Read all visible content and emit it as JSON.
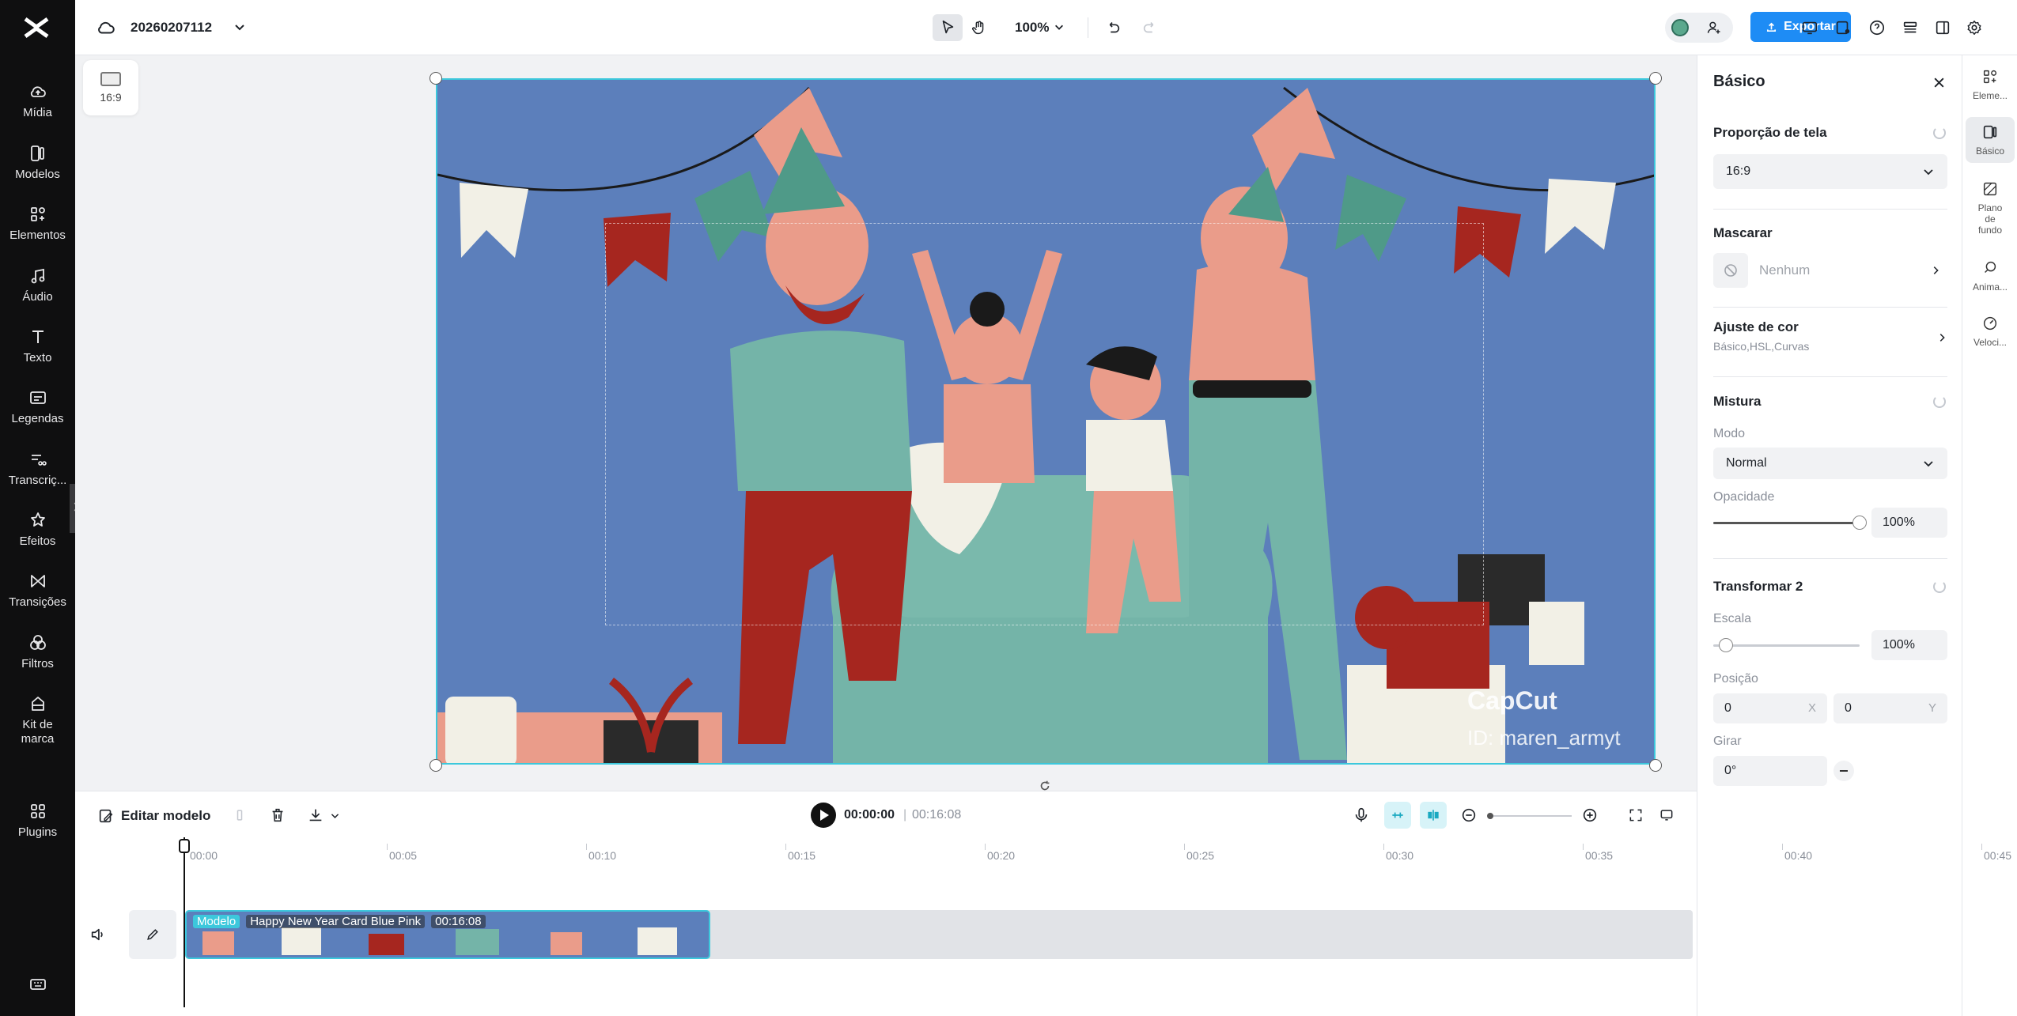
{
  "sidebar": {
    "items": [
      {
        "label": "Mídia",
        "icon": "cloud-upload-icon"
      },
      {
        "label": "Modelos",
        "icon": "templates-icon"
      },
      {
        "label": "Elementos",
        "icon": "elements-icon"
      },
      {
        "label": "Áudio",
        "icon": "music-note-icon"
      },
      {
        "label": "Texto",
        "icon": "text-icon"
      },
      {
        "label": "Legendas",
        "icon": "captions-icon"
      },
      {
        "label": "Transcriç...",
        "icon": "transcript-icon"
      },
      {
        "label": "Efeitos",
        "icon": "effects-star-icon"
      },
      {
        "label": "Transições",
        "icon": "transitions-icon"
      },
      {
        "label": "Filtros",
        "icon": "filters-icon"
      },
      {
        "label": "Kit de marca",
        "icon": "brand-kit-icon"
      },
      {
        "label": "Plugins",
        "icon": "plugins-grid-icon"
      }
    ]
  },
  "topbar": {
    "project_name": "20260207112",
    "zoom": "100%",
    "export_label": "Exportar"
  },
  "canvas": {
    "aspect_ratio": "16:9",
    "watermark_brand": "CapCut",
    "watermark_id": "ID: maren_armyt"
  },
  "panel": {
    "title": "Básico",
    "aspect_section": "Proporção de tela",
    "aspect_value": "16:9",
    "mask_section": "Mascarar",
    "mask_value": "Nenhum",
    "color_section": "Ajuste de cor",
    "color_sub": "Básico,HSL,Curvas",
    "blend_section": "Mistura",
    "mode_label": "Modo",
    "mode_value": "Normal",
    "opacity_label": "Opacidade",
    "opacity_value": "100%",
    "opacity_level": 1.0,
    "transform_section": "Transformar 2",
    "scale_label": "Escala",
    "scale_value": "100%",
    "position_label": "Posição",
    "pos_x": "0",
    "pos_x_tag": "X",
    "pos_y": "0",
    "pos_y_tag": "Y",
    "rotate_label": "Girar",
    "rotate_value": "0°"
  },
  "right_tabs": [
    {
      "label": "Eleme...",
      "icon": "elements-icon"
    },
    {
      "label": "Básico",
      "icon": "basic-icon"
    },
    {
      "label": "Plano de fundo",
      "icon": "background-icon"
    },
    {
      "label": "Anima...",
      "icon": "animation-icon"
    },
    {
      "label": "Veloci...",
      "icon": "speed-icon"
    }
  ],
  "timeline": {
    "edit_label": "Editar modelo",
    "current_time": "00:00:00",
    "separator": "|",
    "total_time": "00:16:08",
    "ruler": [
      "00:00",
      "00:05",
      "00:10",
      "00:15",
      "00:20",
      "00:25",
      "00:30",
      "00:35",
      "00:40",
      "00:45"
    ],
    "clip_tag": "Modelo",
    "clip_name": "Happy New Year Card Blue Pink",
    "clip_duration": "00:16:08"
  },
  "colors": {
    "accent": "#3cc8dc",
    "export_blue": "#1e8cf5",
    "video_bg": "#5c7fbb"
  }
}
